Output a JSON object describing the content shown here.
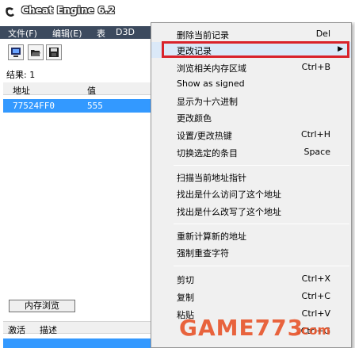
{
  "window": {
    "title": "Cheat Engine 6.2"
  },
  "menubar": {
    "items": [
      "文件(F)",
      "编辑(E)",
      "表",
      "D3D"
    ]
  },
  "results": {
    "label": "结果: 1"
  },
  "list": {
    "headers": [
      "地址",
      "值"
    ],
    "rows": [
      {
        "address": "77524FF0",
        "value": "555"
      }
    ]
  },
  "memory_view_button": "内存浏览",
  "bottom_headers": [
    "激活",
    "描述"
  ],
  "context_menu": {
    "items": [
      {
        "label": "删除当前记录",
        "shortcut": "Del"
      },
      {
        "label": "更改记录",
        "shortcut": "",
        "submenu": true,
        "highlighted": true
      },
      {
        "label": "浏览相关内存区域",
        "shortcut": "Ctrl+B"
      },
      {
        "label": "Show as signed",
        "shortcut": ""
      },
      {
        "label": "显示为十六进制",
        "shortcut": ""
      },
      {
        "label": "更改颜色",
        "shortcut": ""
      },
      {
        "label": "设置/更改热键",
        "shortcut": "Ctrl+H"
      },
      {
        "label": "切换选定的条目",
        "shortcut": "Space"
      },
      {
        "label": "扫描当前地址指针",
        "shortcut": ""
      },
      {
        "label": "找出是什么访问了这个地址",
        "shortcut": ""
      },
      {
        "label": "找出是什么改写了这个地址",
        "shortcut": ""
      },
      {
        "label": "重新计算新的地址",
        "shortcut": ""
      },
      {
        "label": "强制重查字符",
        "shortcut": ""
      },
      {
        "label": "剪切",
        "shortcut": "Ctrl+X"
      },
      {
        "label": "复制",
        "shortcut": "Ctrl+C"
      },
      {
        "label": "粘贴",
        "shortcut": "Ctrl+V"
      },
      {
        "label": "",
        "shortcut": "Ctrl+G"
      }
    ]
  },
  "watermark": {
    "text": "GAME773",
    "domain": ".com"
  },
  "colors": {
    "selection": "#3399ff",
    "menubar": "#3c4a5e",
    "highlight_border": "#d9232b",
    "watermark": "#e8542a"
  }
}
